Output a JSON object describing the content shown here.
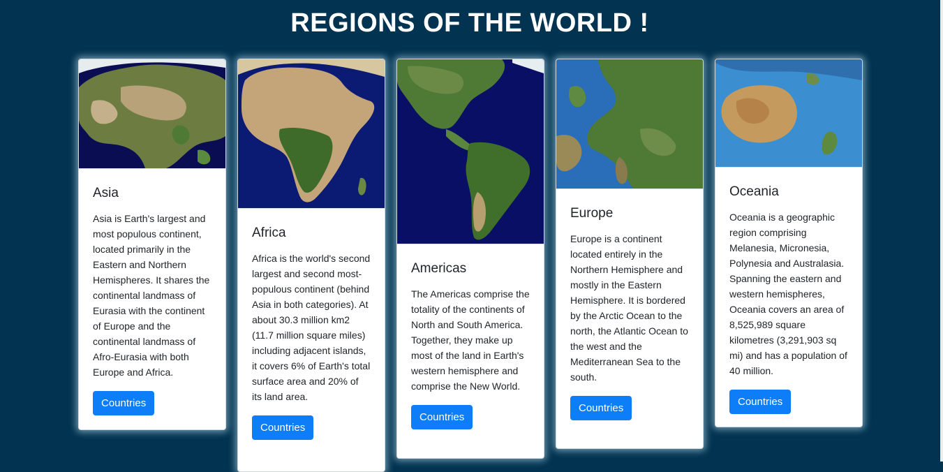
{
  "page": {
    "title": "REGIONS OF THE WORLD !"
  },
  "cards": [
    {
      "title": "Asia",
      "text": "Asia is Earth's largest and most populous continent, located primarily in the Eastern and Northern Hemispheres. It shares the continental landmass of Eurasia with the continent of Europe and the continental landmass of Afro-Eurasia with both Europe and Africa.",
      "button": "Countries",
      "image": "asia-map-image"
    },
    {
      "title": "Africa",
      "text": "Africa is the world's second largest and second most-populous continent (behind Asia in both categories). At about 30.3 million km2 (11.7 million square miles) including adjacent islands, it covers 6% of Earth's total surface area and 20% of its land area.",
      "button": "Countries",
      "image": "africa-map-image"
    },
    {
      "title": "Americas",
      "text": "The Americas comprise the totality of the continents of North and South America. Together, they make up most of the land in Earth's western hemisphere and comprise the New World.",
      "button": "Countries",
      "image": "americas-map-image"
    },
    {
      "title": "Europe",
      "text": "Europe is a continent located entirely in the Northern Hemisphere and mostly in the Eastern Hemisphere. It is bordered by the Arctic Ocean to the north, the Atlantic Ocean to the west and the Mediterranean Sea to the south.",
      "button": "Countries",
      "image": "europe-map-image"
    },
    {
      "title": "Oceania",
      "text": "Oceania is a geographic region comprising Melanesia, Micronesia, Polynesia and Australasia. Spanning the eastern and western hemispheres, Oceania covers an area of 8,525,989 square kilometres (3,291,903 sq mi) and has a population of 40 million.",
      "button": "Countries",
      "image": "oceania-map-image"
    }
  ],
  "colors": {
    "background": "#023451",
    "button": "#0d7ef8",
    "ocean_dark": "#0a0f5e",
    "ocean_light": "#2f7fc9"
  }
}
